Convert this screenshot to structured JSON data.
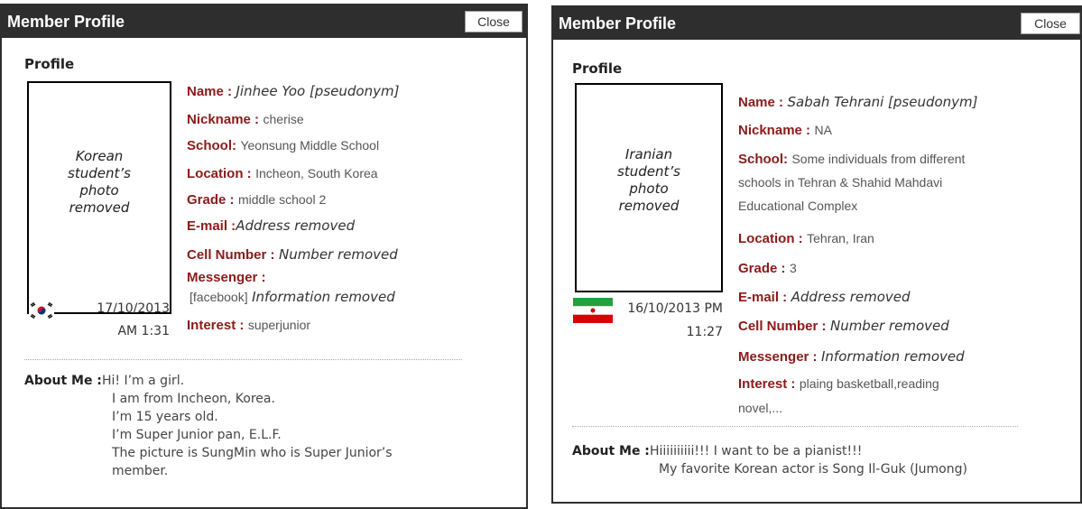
{
  "left": {
    "header": {
      "title": "Member Profile",
      "close_label": "Close"
    },
    "section_title": "Profile",
    "photo_text": [
      "Korean",
      "student’s",
      "photo",
      "removed"
    ],
    "date": [
      "17/10/2013",
      "AM 1:31"
    ],
    "flag_icon": "south-korea-flag",
    "fields": {
      "name": {
        "label": "Name :",
        "value": "Jinhee Yoo [pseudonym]"
      },
      "nickname": {
        "label": "Nickname :",
        "value": "cherise"
      },
      "school": {
        "label": "School:",
        "value": "Yeonsung Middle School"
      },
      "location": {
        "label": "Location :",
        "value": "Incheon, South Korea"
      },
      "grade": {
        "label": "Grade :",
        "value": "middle school 2"
      },
      "email": {
        "label": "E-mail :",
        "value": "Address removed"
      },
      "cell": {
        "label": "Cell Number :",
        "value": "Number removed"
      },
      "messenger": {
        "label": "Messenger :",
        "prefix": "[facebook]",
        "value": "Information removed"
      },
      "interest": {
        "label": "Interest :",
        "value": "superjunior"
      }
    },
    "about": {
      "label": "About Me :",
      "lines": [
        "Hi! I’m a girl.",
        "I am from Incheon, Korea.",
        "I’m 15 years old.",
        "I’m Super Junior pan, E.L.F.",
        "The picture is SungMin who is Super Junior’s",
        "member."
      ]
    }
  },
  "right": {
    "header": {
      "title": "Member Profile",
      "close_label": "Close"
    },
    "section_title": "Profile",
    "photo_text": [
      "Iranian",
      "student’s",
      "photo",
      "removed"
    ],
    "date": [
      "16/10/2013 PM",
      "11:27"
    ],
    "flag_icon": "iran-flag",
    "fields": {
      "name": {
        "label": "Name :",
        "value": "Sabah Tehrani [pseudonym]"
      },
      "nickname": {
        "label": "Nickname :",
        "value": "NA"
      },
      "school": {
        "label": "School:",
        "lines": [
          "Some individuals from different",
          "schools in Tehran & Shahid Mahdavi",
          "Educational Complex"
        ]
      },
      "location": {
        "label": "Location :",
        "value": "Tehran, Iran"
      },
      "grade": {
        "label": "Grade :",
        "value": "3"
      },
      "email": {
        "label": "E-mail :",
        "value": "Address removed"
      },
      "cell": {
        "label": "Cell Number :",
        "value": "Number removed"
      },
      "messenger": {
        "label": "Messenger :",
        "value": "Information removed"
      },
      "interest": {
        "label": "Interest :",
        "lines": [
          "plaing basketball,reading",
          "novel,..."
        ]
      }
    },
    "about": {
      "label": "About Me :",
      "lines": [
        "Hiiiiiiiiii!!!  I want to be a pianist!!!",
        "My favorite Korean actor is Song Il-Guk (Jumong)"
      ]
    }
  },
  "colors": {
    "header_bg": "#2e2e2e",
    "label_red": "#8b1a1a"
  }
}
